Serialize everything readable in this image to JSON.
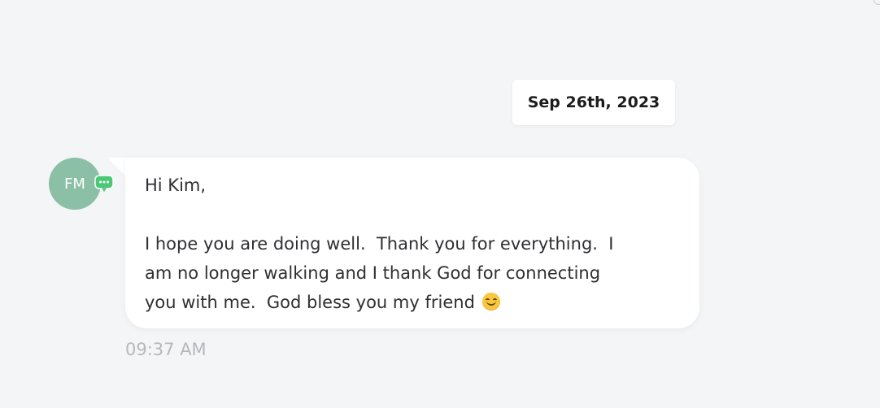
{
  "conversation": {
    "date_divider": "Sep 26th, 2023",
    "message": {
      "sender_initials": "FM",
      "avatar_color": "#8cc0a6",
      "channel_icon": "chat-bubble-icon",
      "channel_icon_color": "#4cc777",
      "lines": [
        "Hi Kim,",
        "",
        "I hope you are doing well.  Thank you for everything.  I",
        "am no longer walking and I thank God for connecting",
        "you with me.  God bless you my friend"
      ],
      "emoji": "smiling-face-emoji",
      "time": "09:37 AM"
    }
  },
  "colors": {
    "background": "#f4f5f7",
    "bubble": "#ffffff",
    "text": "#2f2f33",
    "timestamp": "#b6b8bd"
  }
}
